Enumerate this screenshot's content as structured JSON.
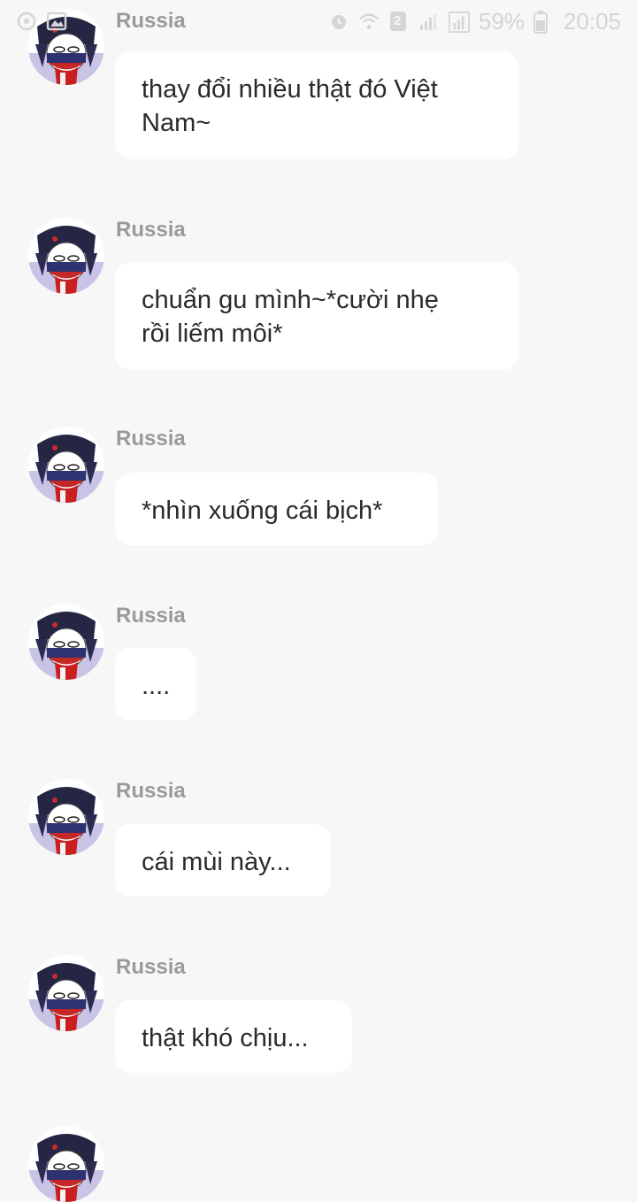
{
  "status_bar": {
    "battery_percent": "59%",
    "time": "20:05",
    "sim_number": "2"
  },
  "chat": {
    "messages": [
      {
        "sender": "Russia",
        "text": "thay đổi nhiều thật đó Việt\nNam~"
      },
      {
        "sender": "Russia",
        "text": "chuẩn gu mình~*cười nhẹ\nrồi liếm môi*"
      },
      {
        "sender": "Russia",
        "text": "*nhìn xuống cái bịch*"
      },
      {
        "sender": "Russia",
        "text": "...."
      },
      {
        "sender": "Russia",
        "text": "cái mùi này..."
      },
      {
        "sender": "Russia",
        "text": "thật khó chịu..."
      }
    ]
  },
  "icons": {
    "avatar": "russia-countryhuman-avatar",
    "status": [
      "notification-icon",
      "gallery-icon",
      "alarm-icon",
      "wifi-icon",
      "sim-icon",
      "signal-icon",
      "battery-icon"
    ]
  }
}
